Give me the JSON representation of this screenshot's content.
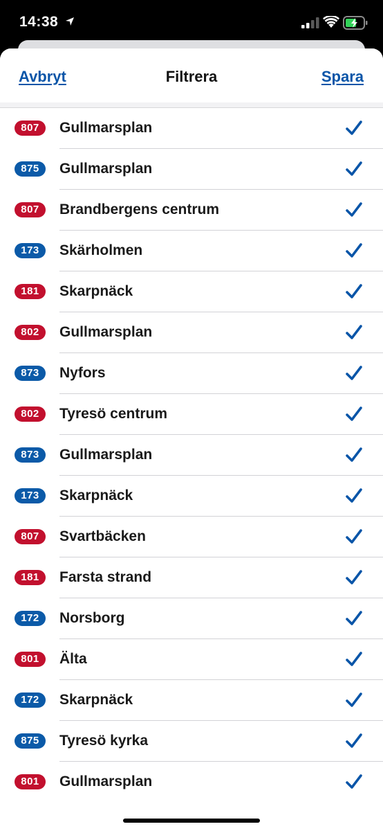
{
  "status": {
    "time": "14:38"
  },
  "nav": {
    "cancel_label": "Avbryt",
    "title": "Filtrera",
    "save_label": "Spara"
  },
  "colors": {
    "accent": "#0a55a8",
    "badge_red": "#c2102e",
    "badge_blue": "#0b5aa8"
  },
  "rows": [
    {
      "line": "807",
      "color": "red",
      "destination": "Gullmarsplan",
      "checked": true
    },
    {
      "line": "875",
      "color": "blue",
      "destination": "Gullmarsplan",
      "checked": true
    },
    {
      "line": "807",
      "color": "red",
      "destination": "Brandbergens centrum",
      "checked": true
    },
    {
      "line": "173",
      "color": "blue",
      "destination": "Skärholmen",
      "checked": true
    },
    {
      "line": "181",
      "color": "red",
      "destination": "Skarpnäck",
      "checked": true
    },
    {
      "line": "802",
      "color": "red",
      "destination": "Gullmarsplan",
      "checked": true
    },
    {
      "line": "873",
      "color": "blue",
      "destination": "Nyfors",
      "checked": true
    },
    {
      "line": "802",
      "color": "red",
      "destination": "Tyresö centrum",
      "checked": true
    },
    {
      "line": "873",
      "color": "blue",
      "destination": "Gullmarsplan",
      "checked": true
    },
    {
      "line": "173",
      "color": "blue",
      "destination": "Skarpnäck",
      "checked": true
    },
    {
      "line": "807",
      "color": "red",
      "destination": "Svartbäcken",
      "checked": true
    },
    {
      "line": "181",
      "color": "red",
      "destination": "Farsta strand",
      "checked": true
    },
    {
      "line": "172",
      "color": "blue",
      "destination": "Norsborg",
      "checked": true
    },
    {
      "line": "801",
      "color": "red",
      "destination": "Älta",
      "checked": true
    },
    {
      "line": "172",
      "color": "blue",
      "destination": "Skarpnäck",
      "checked": true
    },
    {
      "line": "875",
      "color": "blue",
      "destination": "Tyresö kyrka",
      "checked": true
    },
    {
      "line": "801",
      "color": "red",
      "destination": "Gullmarsplan",
      "checked": true
    }
  ]
}
